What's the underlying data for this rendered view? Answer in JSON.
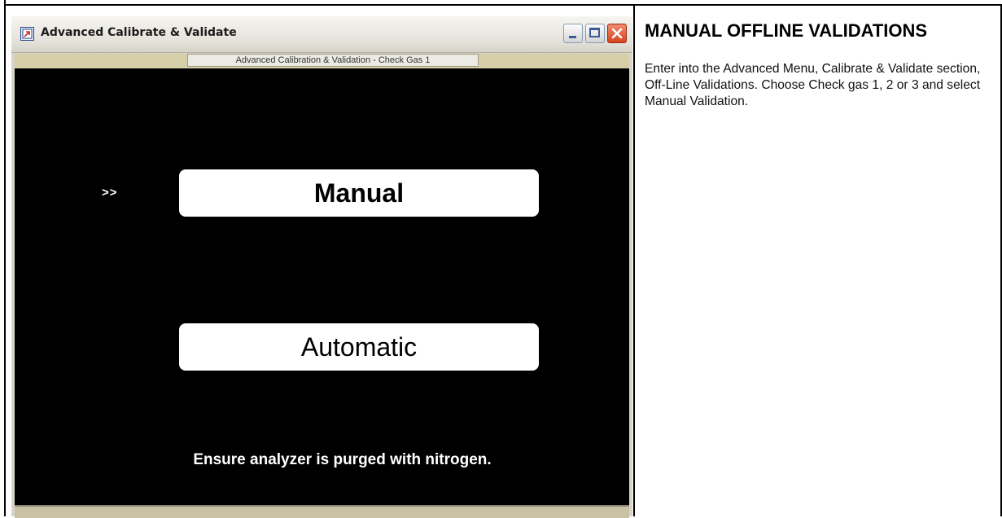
{
  "window": {
    "title": "Advanced Calibrate & Validate",
    "subtitle": "Advanced Calibration & Validation - Check Gas 1",
    "controls": {
      "minimize": "minimize",
      "maximize": "maximize",
      "close": "close"
    }
  },
  "screen": {
    "selector": ">>",
    "options": [
      {
        "label": "Manual",
        "selected": true
      },
      {
        "label": "Automatic",
        "selected": false
      }
    ],
    "notice": "Ensure analyzer is purged with nitrogen."
  },
  "panel": {
    "heading": "MANUAL OFFLINE VALIDATIONS",
    "body": "Enter into the Advanced Menu, Calibrate & Validate section, Off-Line Validations. Choose Check gas 1, 2 or 3 and select Manual Validation."
  },
  "colors": {
    "screen_bg": "#000000",
    "button_bg": "#ffffff",
    "close_button": "#d8431f",
    "subtitle_bar": "#d6cfa8"
  },
  "icons": {
    "app": "app-window-icon",
    "minimize": "minimize-icon",
    "maximize": "maximize-icon",
    "close": "close-icon"
  }
}
